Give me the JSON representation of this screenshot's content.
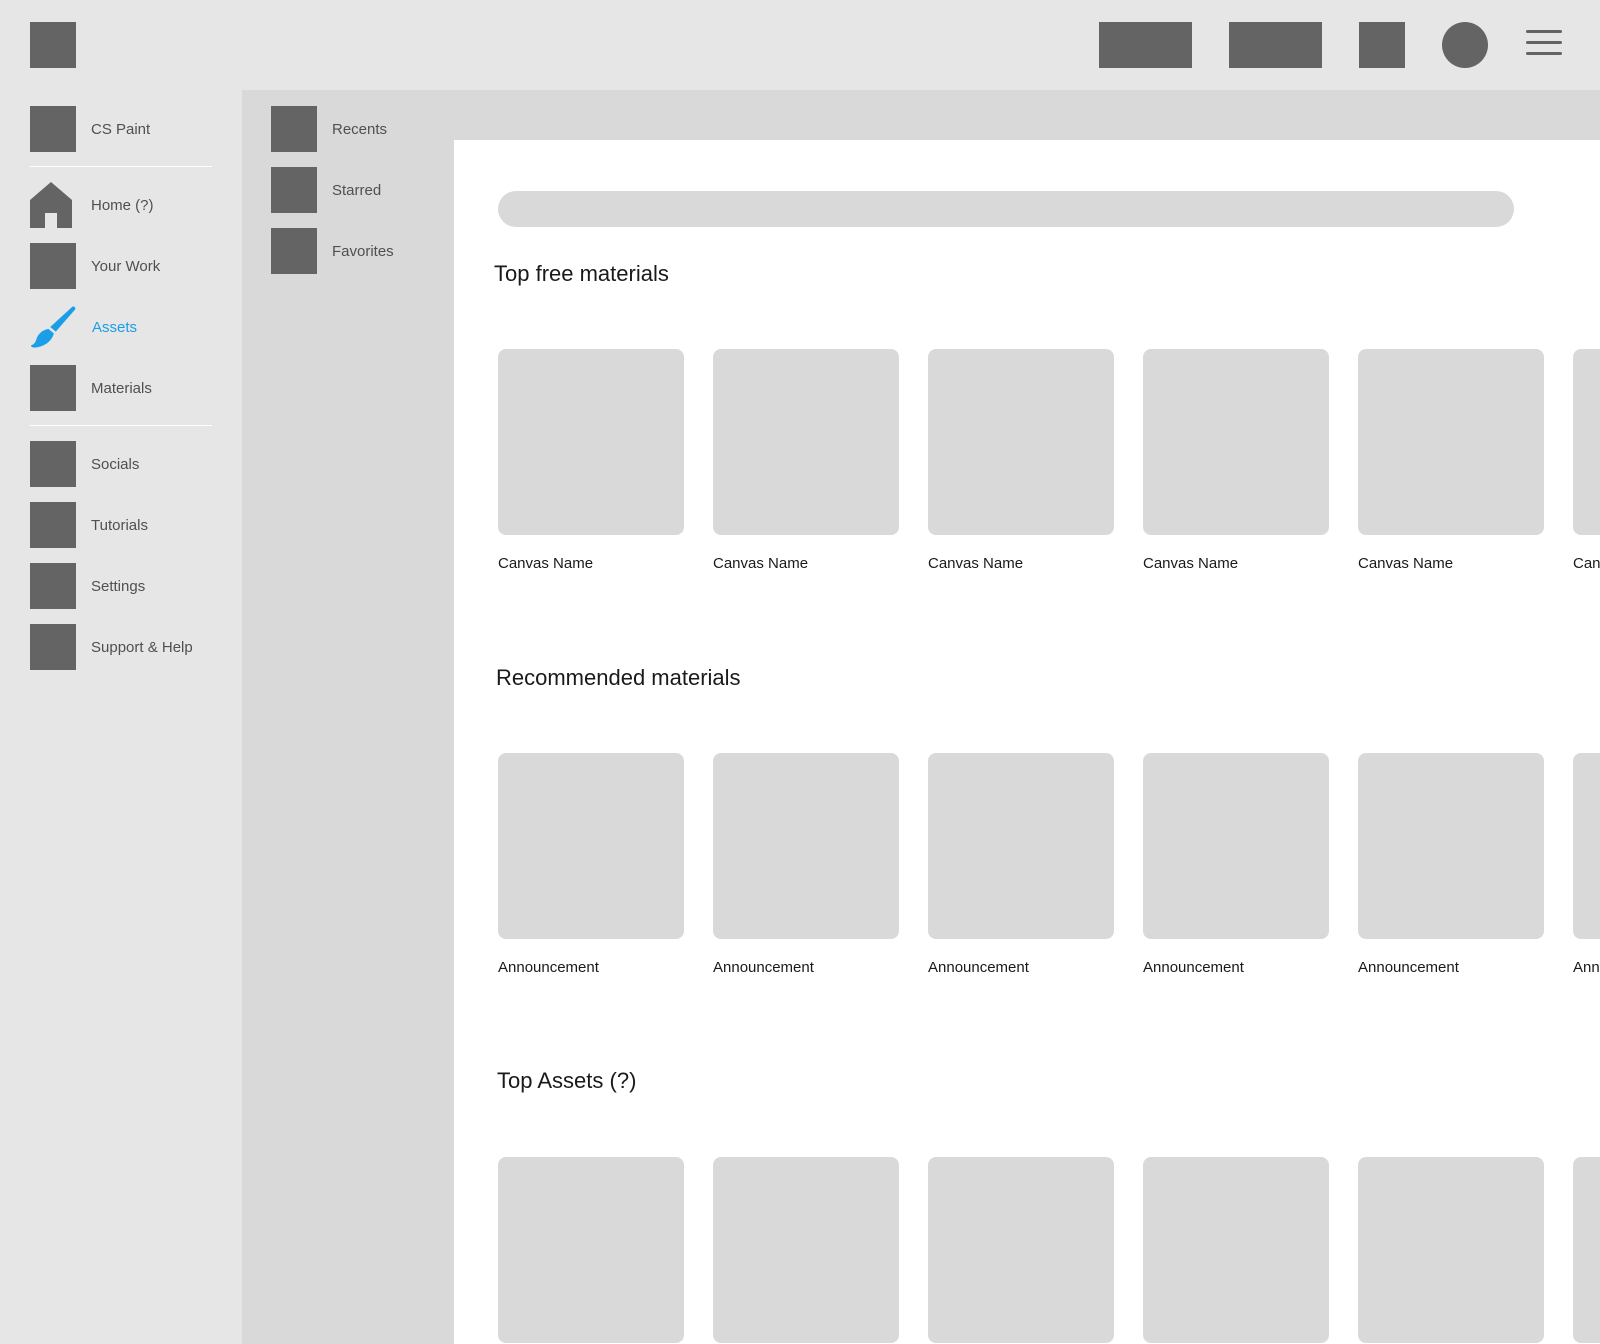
{
  "topbar": {
    "logo_icon": "app-logo-placeholder",
    "buttons": [
      "button-placeholder",
      "button-placeholder",
      "square-button-placeholder"
    ],
    "avatar_icon": "avatar",
    "menu_icon": "hamburger-menu-icon"
  },
  "sidebar": {
    "items": [
      {
        "label": "CS Paint",
        "icon": "placeholder-icon"
      },
      {
        "label": "Home (?)",
        "icon": "home-icon"
      },
      {
        "label": "Your Work",
        "icon": "placeholder-icon"
      },
      {
        "label": "Assets",
        "icon": "paintbrush-icon",
        "active": true
      },
      {
        "label": "Materials",
        "icon": "placeholder-icon"
      },
      {
        "label": "Socials",
        "icon": "placeholder-icon"
      },
      {
        "label": "Tutorials",
        "icon": "placeholder-icon"
      },
      {
        "label": "Settings",
        "icon": "placeholder-icon"
      },
      {
        "label": "Support & Help",
        "icon": "placeholder-icon"
      }
    ]
  },
  "subpanel": {
    "items": [
      {
        "label": "Recents"
      },
      {
        "label": "Starred"
      },
      {
        "label": "Favorites"
      }
    ]
  },
  "main": {
    "search_placeholder": "",
    "sections": [
      {
        "title": "Top free materials",
        "cards": [
          "Canvas Name",
          "Canvas Name",
          "Canvas Name",
          "Canvas Name",
          "Canvas Name",
          "Canvas Name"
        ]
      },
      {
        "title": "Recommended materials",
        "cards": [
          "Announcement",
          "Announcement",
          "Announcement",
          "Announcement",
          "Announcement",
          "Announcement"
        ]
      },
      {
        "title": "Top Assets (?)",
        "cards": [
          "",
          "",
          "",
          "",
          "",
          ""
        ]
      }
    ]
  },
  "colors": {
    "accent": "#1a9ee8",
    "placeholder": "#646464",
    "panel": "#d9d9d9",
    "background": "#e6e6e6"
  }
}
